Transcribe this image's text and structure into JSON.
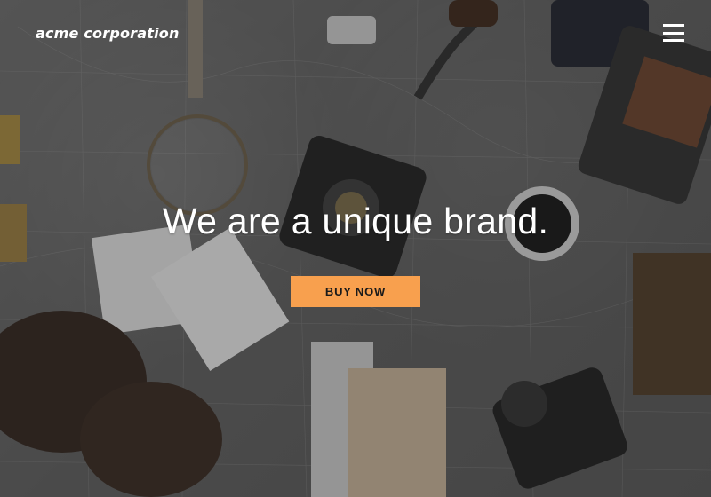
{
  "header": {
    "logo_text": "acme corporation",
    "menu_icon": "hamburger-menu-icon"
  },
  "hero": {
    "headline": "We are a unique brand.",
    "cta_label": "BUY NOW"
  },
  "colors": {
    "cta_background": "#f8a04e",
    "text": "#ffffff",
    "overlay": "#5d5d5d"
  }
}
